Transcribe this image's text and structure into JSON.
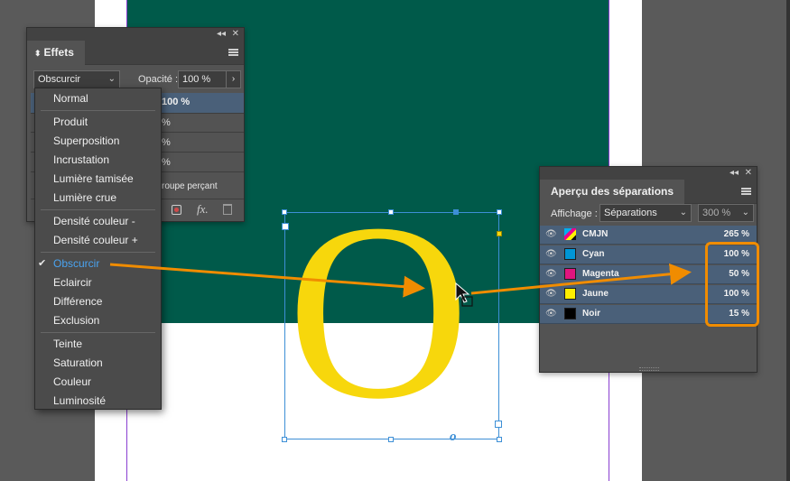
{
  "effects_panel": {
    "tab_label": "Effets",
    "blend_mode": "Obscurcir",
    "opacity_label": "Opacité :",
    "opacity_value": "100 %",
    "layer_value": "100 %",
    "row2": "%",
    "row3": "%",
    "row4": "%",
    "knockout_label": "roupe perçant"
  },
  "blend_menu": {
    "items": [
      {
        "label": "Normal"
      },
      {
        "label": "Produit"
      },
      {
        "label": "Superposition"
      },
      {
        "label": "Incrustation"
      },
      {
        "label": "Lumière tamisée"
      },
      {
        "label": "Lumière crue"
      },
      {
        "label": "Densité couleur -"
      },
      {
        "label": "Densité couleur +"
      },
      {
        "label": "Obscurcir"
      },
      {
        "label": "Eclaircir"
      },
      {
        "label": "Différence"
      },
      {
        "label": "Exclusion"
      },
      {
        "label": "Teinte"
      },
      {
        "label": "Saturation"
      },
      {
        "label": "Couleur"
      },
      {
        "label": "Luminosité"
      }
    ],
    "selected": "Obscurcir",
    "check": "✔"
  },
  "separations_panel": {
    "tab_label": "Aperçu des séparations",
    "view_label": "Affichage :",
    "view_value": "Séparations",
    "zoom_value": "300 %",
    "rows": [
      {
        "name": "CMJN",
        "value": "265 %",
        "color": "cmyk"
      },
      {
        "name": "Cyan",
        "value": "100 %",
        "color": "#0096d6"
      },
      {
        "name": "Magenta",
        "value": "50 %",
        "color": "#e0157f"
      },
      {
        "name": "Jaune",
        "value": "100 %",
        "color": "#ffee00"
      },
      {
        "name": "Noir",
        "value": "15 %",
        "color": "#000000"
      }
    ]
  },
  "canvas": {
    "letter": "O",
    "frame_marker": "o",
    "page_color": "#ffffff",
    "green_color": "#005a4a",
    "letter_color": "#f7d70c"
  },
  "annotations": {
    "arrow_color": "#f08c00",
    "highlight_color": "#f08c00"
  }
}
